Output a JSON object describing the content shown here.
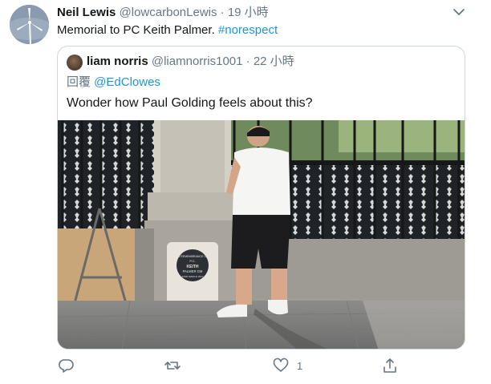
{
  "tweet": {
    "display_name": "Neil Lewis",
    "handle": "@lowcarbonLewis",
    "separator": "·",
    "time": "19 小時",
    "text": "Memorial to PC Keith Palmer. ",
    "hashtag": "#norespect",
    "avatar_icon": "wind-turbine-icon"
  },
  "quoted": {
    "display_name": "liam norris",
    "handle": "@liamnorris1001",
    "separator": "·",
    "time": "22 小時",
    "reply_prefix": "回覆 ",
    "reply_to": "@EdClowes",
    "text": "Wonder how Paul Golding feels about this?"
  },
  "photo": {
    "plaque_lines": [
      "IN REMEMBRANCE OF",
      "P.C.",
      "KEITH",
      "PALMER GM",
      "22ND MARCH 2017"
    ]
  },
  "actions": {
    "reply_icon": "reply-icon",
    "retweet_icon": "retweet-icon",
    "like_icon": "heart-icon",
    "like_count": "1",
    "share_icon": "share-icon"
  },
  "colors": {
    "link": "#1b95e0",
    "secondary_text": "#657786",
    "border": "#ccd6dd"
  }
}
